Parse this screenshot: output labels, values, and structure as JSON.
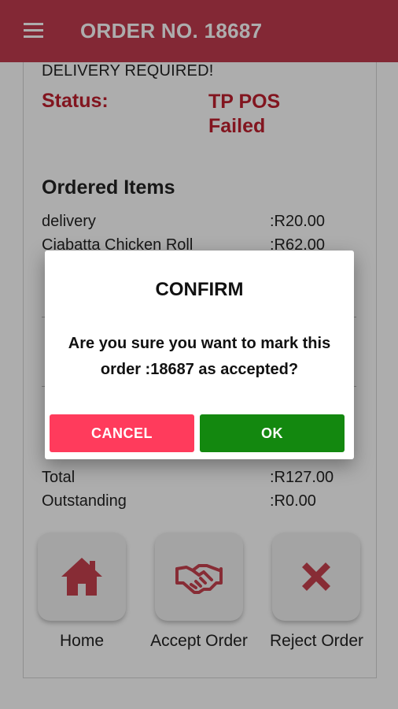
{
  "appbar": {
    "title": "ORDER NO. 18687",
    "menu_icon": "menu-icon"
  },
  "order": {
    "delivery_note": "DELIVERY REQUIRED!",
    "status_label": "Status:",
    "status_value": "TP POS Failed",
    "items_title": "Ordered Items",
    "items": [
      {
        "label": "delivery",
        "value": ":R20.00"
      },
      {
        "label": "Ciabatta Chicken Roll",
        "value": ":R62.00"
      }
    ],
    "totals": [
      {
        "label": "Total",
        "value": ":R127.00"
      },
      {
        "label": "Outstanding",
        "value": ":R0.00"
      }
    ]
  },
  "actions": [
    {
      "label": "Home",
      "icon": "home-icon"
    },
    {
      "label": "Accept Order",
      "icon": "handshake-icon"
    },
    {
      "label": "Reject Order",
      "icon": "x-icon"
    }
  ],
  "dialog": {
    "title": "CONFIRM",
    "message": "Are you sure you want to mark this order :18687 as accepted?",
    "cancel_label": "CANCEL",
    "ok_label": "OK"
  },
  "colors": {
    "appbar": "#c23c4f",
    "status": "#c0202e",
    "icon": "#c8424f",
    "cancel": "#ff3b5c",
    "ok": "#13880f"
  }
}
